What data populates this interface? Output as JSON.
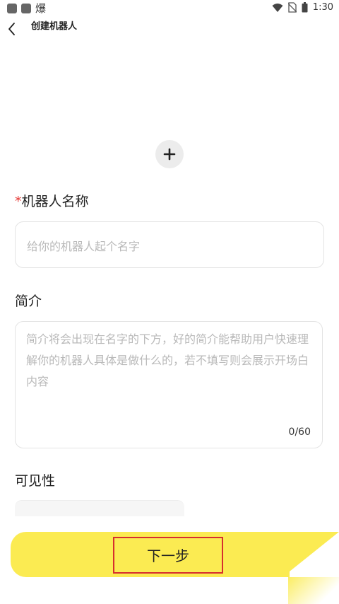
{
  "status_bar": {
    "app_glyph": "爆",
    "time": "1:30",
    "icons": [
      "wifi-icon",
      "no-sim-icon",
      "battery-icon"
    ]
  },
  "header": {
    "title": "创建机器人",
    "back_icon": "chevron-left-icon"
  },
  "avatar": {
    "icon": "plus-icon"
  },
  "name_section": {
    "required_mark": "*",
    "label": "机器人名称",
    "placeholder": "给你的机器人起个名字"
  },
  "intro_section": {
    "label": "简介",
    "placeholder": "简介将会出现在名字的下方，好的简介能帮助用户快速理解你的机器人具体是做什么的，若不填写则会展示开场白内容",
    "counter": "0/60"
  },
  "visibility_section": {
    "label": "可见性"
  },
  "footer": {
    "next_label": "下一步",
    "colors": {
      "button": "#fbeb52",
      "highlight": "#d62e2e"
    }
  }
}
